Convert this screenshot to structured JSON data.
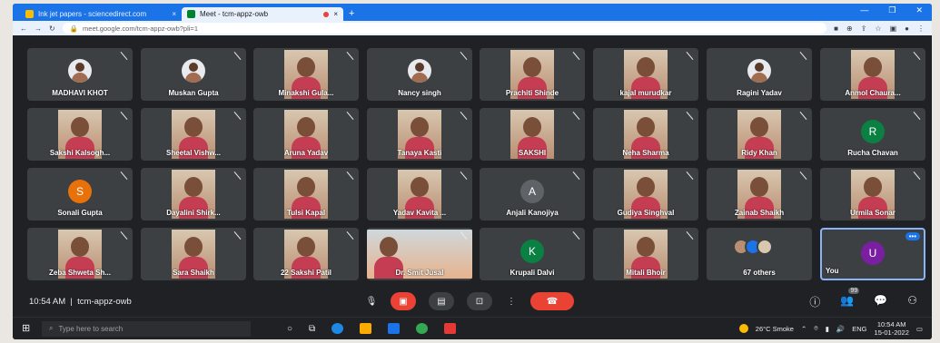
{
  "browser": {
    "tabs": [
      {
        "title": "Ink jet papers - sciencedirect.com"
      },
      {
        "title": "Meet - tcm-appz-owb"
      }
    ],
    "url": "meet.google.com/tcm-appz-owb?pli=1",
    "new_tab_glyph": "+",
    "close_glyph": "×"
  },
  "meet": {
    "tiles": [
      {
        "name": "MADHAVI KHOT",
        "kind": "avatar"
      },
      {
        "name": "Muskan Gupta",
        "kind": "avatar"
      },
      {
        "name": "Minakshi Gula...",
        "kind": "video"
      },
      {
        "name": "Nancy singh",
        "kind": "avatar"
      },
      {
        "name": "Prachiti Shinde",
        "kind": "video"
      },
      {
        "name": "kajal murudkar",
        "kind": "video"
      },
      {
        "name": "Ragini Yadav",
        "kind": "avatar"
      },
      {
        "name": "Anmol Chaura...",
        "kind": "video"
      },
      {
        "name": "Sakshi Kalsogh...",
        "kind": "video"
      },
      {
        "name": "Sheetal Vishw...",
        "kind": "video"
      },
      {
        "name": "Aruna Yadav",
        "kind": "video"
      },
      {
        "name": "Tanaya Kasti",
        "kind": "video"
      },
      {
        "name": "SAKSHI",
        "kind": "video"
      },
      {
        "name": "Neha Sharma",
        "kind": "video"
      },
      {
        "name": "Ridy Khan",
        "kind": "video"
      },
      {
        "name": "Rucha Chavan",
        "kind": "letter",
        "letter": "R",
        "color": "#0b8043"
      },
      {
        "name": "Sonali Gupta",
        "kind": "letter",
        "letter": "S",
        "color": "#e8710a"
      },
      {
        "name": "Dayalini Shirk...",
        "kind": "video"
      },
      {
        "name": "Tulsi Kapal",
        "kind": "video"
      },
      {
        "name": "Yadav Kavita ...",
        "kind": "video"
      },
      {
        "name": "Anjali Kanojiya",
        "kind": "letter",
        "letter": "A",
        "color": "#5f6368"
      },
      {
        "name": "Gudiya Singhval",
        "kind": "video"
      },
      {
        "name": "Zainab Shaikh",
        "kind": "video"
      },
      {
        "name": "Urmila Sonar",
        "kind": "video"
      },
      {
        "name": "Zeba Shweta Sh...",
        "kind": "video"
      },
      {
        "name": "Sara Shaikh",
        "kind": "video"
      },
      {
        "name": "22 Sakshi Patil",
        "kind": "video"
      },
      {
        "name": "Dr. Smit Jusal",
        "kind": "wide"
      },
      {
        "name": "Krupali Dalvi",
        "kind": "letter",
        "letter": "K",
        "color": "#0b8043"
      },
      {
        "name": "Mitali Bhoir",
        "kind": "video"
      },
      {
        "name": "67 others",
        "kind": "others"
      },
      {
        "name": "You",
        "kind": "you",
        "letter": "U",
        "color": "#7b1fa2"
      }
    ],
    "time": "10:54 AM",
    "separator": "|",
    "meeting_code": "tcm-appz-owb",
    "people_count": "99"
  },
  "taskbar": {
    "search_placeholder": "Type here to search",
    "weather": "26°C Smoke",
    "lang": "ENG",
    "clock_time": "10:54 AM",
    "clock_date": "15-01-2022"
  }
}
